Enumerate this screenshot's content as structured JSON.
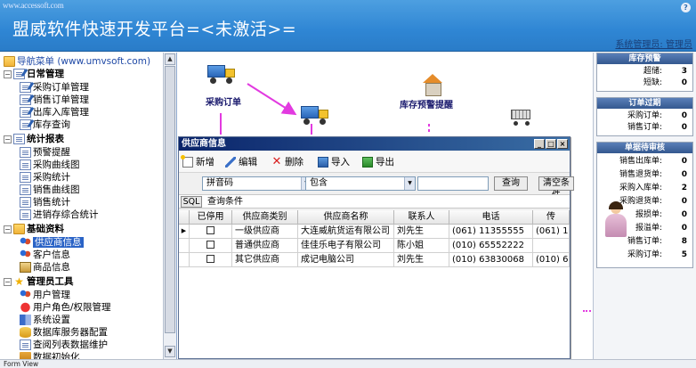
{
  "header": {
    "site_url": "www.accessoft.com",
    "title": "盟威软件快速开发平台=<未激活>=",
    "help": "?",
    "admin": "系统管理员: 管理员"
  },
  "sidebar": {
    "root": "导航菜单 (www.umvsoft.com)",
    "groups": [
      {
        "label": "日常管理",
        "items": [
          "采购订单管理",
          "销售订单管理",
          "出库入库管理",
          "库存查询"
        ]
      },
      {
        "label": "统计报表",
        "items": [
          "预警提醒",
          "采购曲线图",
          "采购统计",
          "销售曲线图",
          "销售统计",
          "进销存综合统计"
        ]
      },
      {
        "label": "基础资料",
        "items": [
          "供应商信息",
          "客户信息",
          "商品信息"
        ]
      },
      {
        "label": "管理员工具",
        "items": [
          "用户管理",
          "用户角色/权限管理",
          "系统设置",
          "数据库服务器配置",
          "查阅列表数据维护",
          "数据初始化"
        ]
      }
    ]
  },
  "flow": {
    "purchase_order": "采购订单",
    "stock_alert": "库存预警提醒"
  },
  "right_panel": {
    "stock_warning": {
      "title": "库存预警",
      "rows": [
        {
          "label": "超储:",
          "value": "3"
        },
        {
          "label": "短缺:",
          "value": "0"
        }
      ]
    },
    "order_expired": {
      "title": "订单过期",
      "rows": [
        {
          "label": "采购订单:",
          "value": "0"
        },
        {
          "label": "销售订单:",
          "value": "0"
        }
      ]
    },
    "pending_review": {
      "title": "单据待审核",
      "rows": [
        {
          "label": "销售出库单:",
          "value": "0"
        },
        {
          "label": "销售退货单:",
          "value": "0"
        },
        {
          "label": "采购入库单:",
          "value": "2"
        },
        {
          "label": "采购退货单:",
          "value": "0"
        },
        {
          "label": "报损单:",
          "value": "0"
        },
        {
          "label": "报溢单:",
          "value": "0"
        },
        {
          "label": "销售订单:",
          "value": "8"
        },
        {
          "label": "采购订单:",
          "value": "5"
        }
      ]
    }
  },
  "dialog": {
    "title": "供应商信息",
    "window_buttons": [
      "_",
      "□",
      "×"
    ],
    "toolbar": {
      "new": "新增",
      "edit": "编辑",
      "delete": "删除",
      "import": "导入",
      "export": "导出"
    },
    "filter": {
      "field": "拼音码",
      "operator": "包含",
      "value": "",
      "search": "查询",
      "clear": "清空条件"
    },
    "sql_tab": "SQL",
    "sql_label": "查询条件",
    "columns": [
      "已停用",
      "供应商类别",
      "供应商名称",
      "联系人",
      "电话",
      "传"
    ],
    "rows": [
      {
        "category": "一级供应商",
        "name": "大连威航货运有限公司",
        "contact": "刘先生",
        "phone": "(061) 11355555",
        "fax": "(061) 11"
      },
      {
        "category": "普通供应商",
        "name": "佳佳乐电子有限公司",
        "contact": "陈小姐",
        "phone": "(010) 65552222",
        "fax": ""
      },
      {
        "category": "其它供应商",
        "name": "成记电脑公司",
        "contact": "刘先生",
        "phone": "(010) 63830068",
        "fax": "(010) 63"
      }
    ]
  },
  "status_bar": {
    "text": "Form View"
  },
  "colors": {
    "header": "#2f86d4",
    "accent_arrow": "#e23ae0",
    "selection": "#2a63c6"
  }
}
